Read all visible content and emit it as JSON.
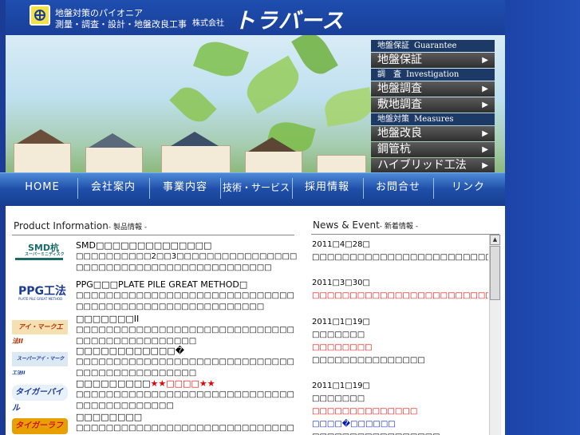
{
  "header": {
    "tagline_line1": "地盤対策のパイオニア",
    "tagline_line2": "測量・調査・設計・地盤改良工事",
    "corp_label": "株式会社",
    "brand_name": "トラバース"
  },
  "side_menu": {
    "sections": [
      {
        "jp": "地盤保証",
        "en": "Guarantee",
        "items": [
          "地盤保証"
        ]
      },
      {
        "jp": "調　査",
        "en": "Investigation",
        "items": [
          "地盤調査",
          "敷地調査"
        ]
      },
      {
        "jp": "地盤対策",
        "en": "Measures",
        "items": [
          "地盤改良",
          "鋼管杭",
          "ハイブリッド工法"
        ]
      }
    ],
    "arrow": "▶"
  },
  "nav": {
    "items": [
      "HOME",
      "会社案内",
      "事業内容",
      "技術・サービス",
      "採用情報",
      "お問合せ",
      "リンク"
    ]
  },
  "products": {
    "heading": "Product Information",
    "heading_sub": "- 製品情報 -",
    "items": [
      {
        "logo": "SMD杭",
        "logo_sub": "スーパーミニディスク",
        "title": "SMD□□□□□□□□□□□□□□",
        "title_red": "",
        "desc": "□□□□□□□□□□2□□3□□□□□□□□□□□□□□□□□□□□□□□□□□□□□□□□□□□□□□□□□□"
      },
      {
        "logo": "PPG工法",
        "logo_sub": "PLATE PILE GREAT METHOD",
        "title": "PPG□□□PLATE PILE GREAT METHOD□",
        "title_red": "",
        "desc": "□□□□□□□□□□□□□□□□□□□□□□□□□□□□□□□□□□□□□□□□□□□□□□□□□□□□□□"
      },
      {
        "logo": "アイ・マーク工法II",
        "logo_sub": "",
        "title": "□□□□□□□II",
        "title_red": "",
        "desc": "□□□□□□□□□□□□□□□□□□□□□□□□□□□□□□□□□□□□□□□□□□□□□"
      },
      {
        "logo": "スーパーアイ・マーク工法II",
        "logo_sub": "",
        "title": "□□□□□□□□□□□□�",
        "title_red": "",
        "desc": "□□□□□□□□□□□□□□□□□□□□□□□□□□□□□□□□□□□□□□□□□□□□□"
      },
      {
        "logo": "タイガーパイル",
        "logo_sub": "",
        "title": "□□□□□□□□□",
        "title_red": "★★□□□□★★",
        "desc": "□□□□□□□□□□□□□□□□□□□□□□□□□□□□□□□□□□□□□□□□□□"
      },
      {
        "logo": "タイガーラフト",
        "logo_sub": "",
        "title": "□□□□□□□□",
        "title_red": "",
        "desc": "□□□□□□□□□□□□□□□□□□□□□□□□□□□□□□□□□□□□□"
      }
    ]
  },
  "news": {
    "heading": "News & Event",
    "heading_sub": "- 新着情報 -",
    "entries": [
      {
        "date": "2011□4□28□",
        "lines": [
          {
            "text": "□□□□□□□□□□□□□□□□□□□□□□□□□□□□□□□□",
            "color": "black"
          }
        ]
      },
      {
        "date": "2011□3□30□",
        "lines": [
          {
            "text": "□□□□□□□□□□□□□□□□□□□□□□□□□□□□□□□□□",
            "color": "red"
          }
        ]
      },
      {
        "date": "2011□1□19□",
        "lines": [
          {
            "text": "□□□□□□□",
            "color": "black"
          },
          {
            "text": "□□□□□□□□",
            "color": "red"
          },
          {
            "text": "",
            "color": "black"
          },
          {
            "text": "□□□□□□□□□□□□□□□",
            "color": "black"
          }
        ]
      },
      {
        "date": "2011□1□19□",
        "lines": [
          {
            "text": "□□□□□□□",
            "color": "black"
          },
          {
            "text": "□□□□□□□□□□□□□□",
            "color": "red"
          },
          {
            "text": "□□□□�□□□□□□",
            "color": "blue"
          },
          {
            "text": "□□□□□□□□□□□□□□□□□",
            "color": "black"
          }
        ]
      }
    ]
  },
  "colors": {
    "brand_blue": "#1a3c96",
    "menu_dark": "#2f2f2f",
    "news_red": "#e00000",
    "news_blue": "#0019b8"
  }
}
